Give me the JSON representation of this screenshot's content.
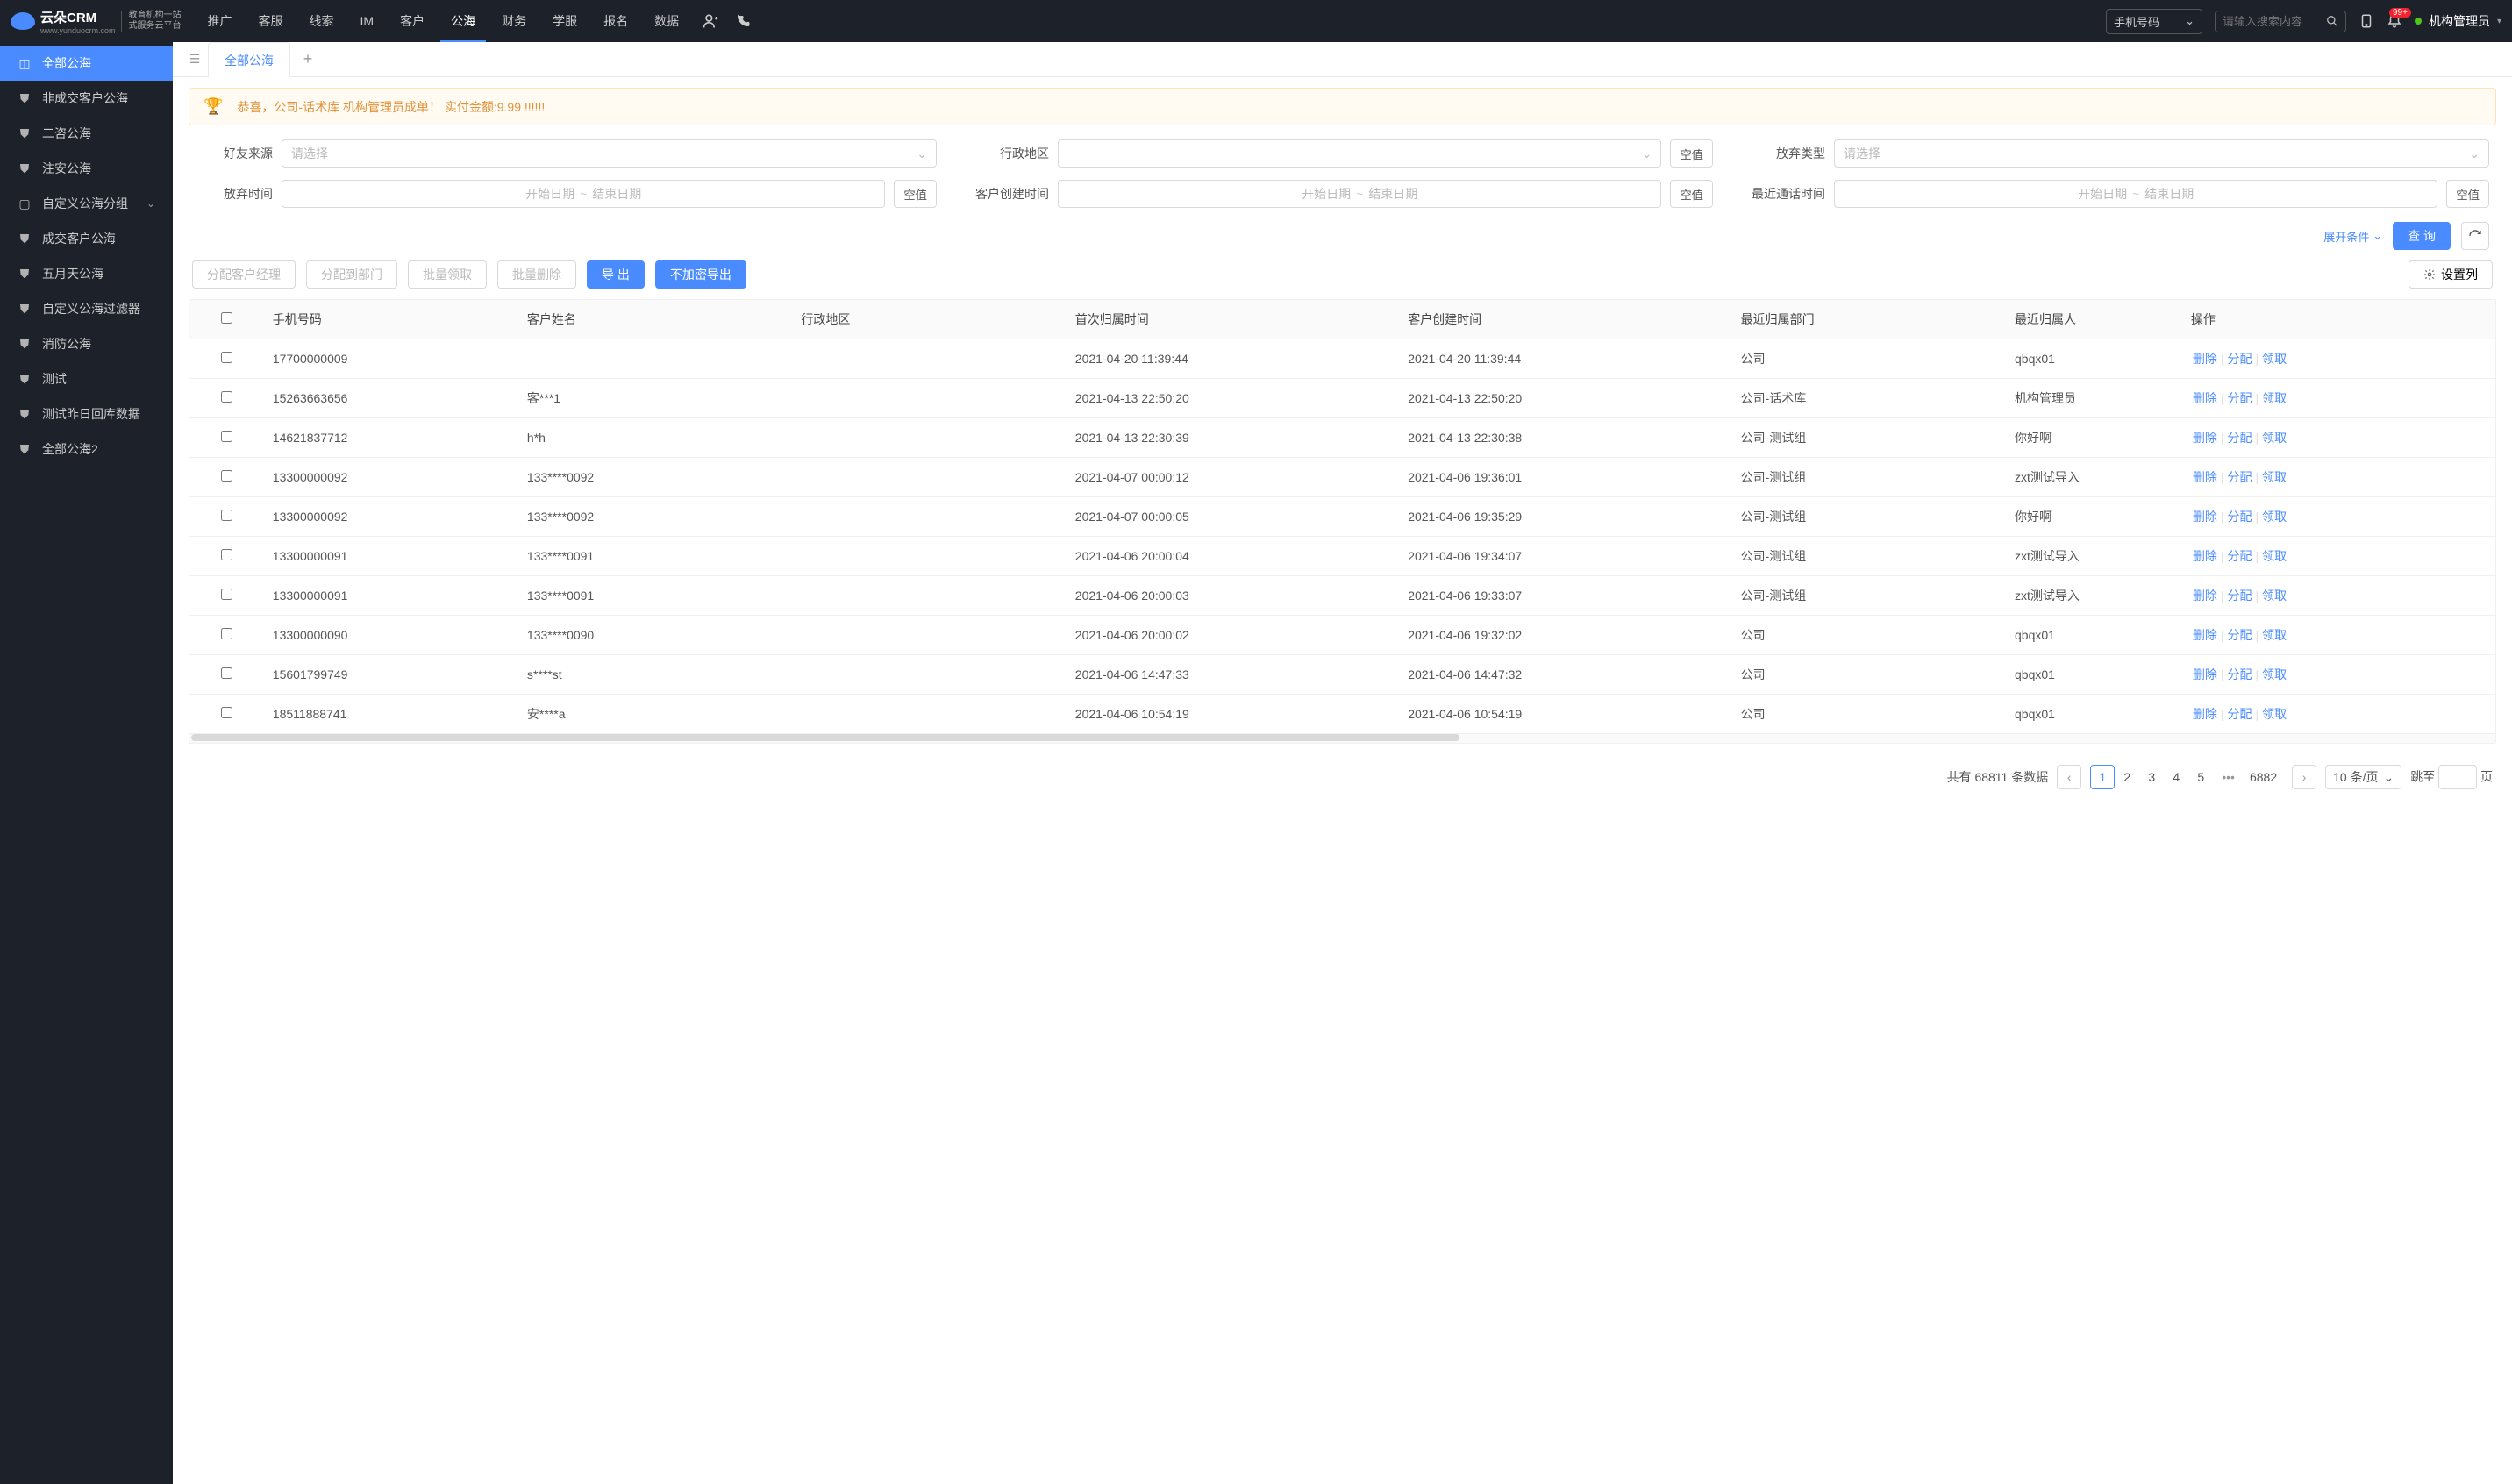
{
  "brand": {
    "name": "云朵CRM",
    "sub1": "教育机构一站",
    "sub2": "式服务云平台",
    "url": "www.yunduocrm.com"
  },
  "topnav": [
    "推广",
    "客服",
    "线索",
    "IM",
    "客户",
    "公海",
    "财务",
    "学服",
    "报名",
    "数据"
  ],
  "topnav_active": 5,
  "search_type": "手机号码",
  "search_placeholder": "请输入搜索内容",
  "badge": "99+",
  "user": "机构管理员",
  "sidebar": [
    {
      "icon": "◫",
      "label": "全部公海",
      "active": true
    },
    {
      "icon": "⛊",
      "label": "非成交客户公海"
    },
    {
      "icon": "⛊",
      "label": "二咨公海"
    },
    {
      "icon": "⛊",
      "label": "注安公海"
    },
    {
      "icon": "▢",
      "label": "自定义公海分组",
      "chev": true
    },
    {
      "icon": "⛊",
      "label": "成交客户公海"
    },
    {
      "icon": "⛊",
      "label": "五月天公海"
    },
    {
      "icon": "⛊",
      "label": "自定义公海过滤器"
    },
    {
      "icon": "⛊",
      "label": "消防公海"
    },
    {
      "icon": "⛊",
      "label": "测试"
    },
    {
      "icon": "⛊",
      "label": "测试昨日回库数据"
    },
    {
      "icon": "⛊",
      "label": "全部公海2"
    }
  ],
  "tab": "全部公海",
  "notice": "恭喜，公司-话术库  机构管理员成单！  实付金额:9.99 !!!!!!",
  "filters": {
    "friend_source": {
      "label": "好友来源",
      "placeholder": "请选择"
    },
    "region": {
      "label": "行政地区",
      "empty": "空值"
    },
    "abandon_type": {
      "label": "放弃类型",
      "placeholder": "请选择"
    },
    "abandon_time": {
      "label": "放弃时间",
      "start": "开始日期",
      "end": "结束日期",
      "empty": "空值"
    },
    "create_time": {
      "label": "客户创建时间",
      "start": "开始日期",
      "end": "结束日期",
      "empty": "空值"
    },
    "last_call": {
      "label": "最近通话时间",
      "start": "开始日期",
      "end": "结束日期",
      "empty": "空值"
    }
  },
  "expand": "展开条件",
  "query_btn": "查 询",
  "toolbar": {
    "assign_mgr": "分配客户经理",
    "assign_dept": "分配到部门",
    "batch_claim": "批量领取",
    "batch_delete": "批量删除",
    "export": "导 出",
    "export_plain": "不加密导出",
    "columns": "设置列"
  },
  "columns": [
    "手机号码",
    "客户姓名",
    "行政地区",
    "首次归属时间",
    "客户创建时间",
    "最近归属部门",
    "最近归属人",
    "操作"
  ],
  "ops": {
    "del": "删除",
    "assign": "分配",
    "claim": "领取"
  },
  "rows": [
    {
      "phone": "17700000009",
      "name": "",
      "region": "",
      "first": "2021-04-20 11:39:44",
      "create": "2021-04-20 11:39:44",
      "dept": "公司",
      "owner": "qbqx01"
    },
    {
      "phone": "15263663656",
      "name": "客***1",
      "region": "",
      "first": "2021-04-13 22:50:20",
      "create": "2021-04-13 22:50:20",
      "dept": "公司-话术库",
      "owner": "机构管理员"
    },
    {
      "phone": "14621837712",
      "name": "h*h",
      "region": "",
      "first": "2021-04-13 22:30:39",
      "create": "2021-04-13 22:30:38",
      "dept": "公司-测试组",
      "owner": "你好啊"
    },
    {
      "phone": "13300000092",
      "name": "133****0092",
      "region": "",
      "first": "2021-04-07 00:00:12",
      "create": "2021-04-06 19:36:01",
      "dept": "公司-测试组",
      "owner": "zxt测试导入"
    },
    {
      "phone": "13300000092",
      "name": "133****0092",
      "region": "",
      "first": "2021-04-07 00:00:05",
      "create": "2021-04-06 19:35:29",
      "dept": "公司-测试组",
      "owner": "你好啊"
    },
    {
      "phone": "13300000091",
      "name": "133****0091",
      "region": "",
      "first": "2021-04-06 20:00:04",
      "create": "2021-04-06 19:34:07",
      "dept": "公司-测试组",
      "owner": "zxt测试导入"
    },
    {
      "phone": "13300000091",
      "name": "133****0091",
      "region": "",
      "first": "2021-04-06 20:00:03",
      "create": "2021-04-06 19:33:07",
      "dept": "公司-测试组",
      "owner": "zxt测试导入"
    },
    {
      "phone": "13300000090",
      "name": "133****0090",
      "region": "",
      "first": "2021-04-06 20:00:02",
      "create": "2021-04-06 19:32:02",
      "dept": "公司",
      "owner": "qbqx01"
    },
    {
      "phone": "15601799749",
      "name": "s****st",
      "region": "",
      "first": "2021-04-06 14:47:33",
      "create": "2021-04-06 14:47:32",
      "dept": "公司",
      "owner": "qbqx01"
    },
    {
      "phone": "18511888741",
      "name": "安****a",
      "region": "",
      "first": "2021-04-06 10:54:19",
      "create": "2021-04-06 10:54:19",
      "dept": "公司",
      "owner": "qbqx01"
    }
  ],
  "pagination": {
    "total_prefix": "共有",
    "total": "68811",
    "total_suffix": "条数据",
    "pages": [
      "1",
      "2",
      "3",
      "4",
      "5"
    ],
    "last": "6882",
    "size": "10 条/页",
    "jump_prefix": "跳至",
    "jump_suffix": "页"
  }
}
